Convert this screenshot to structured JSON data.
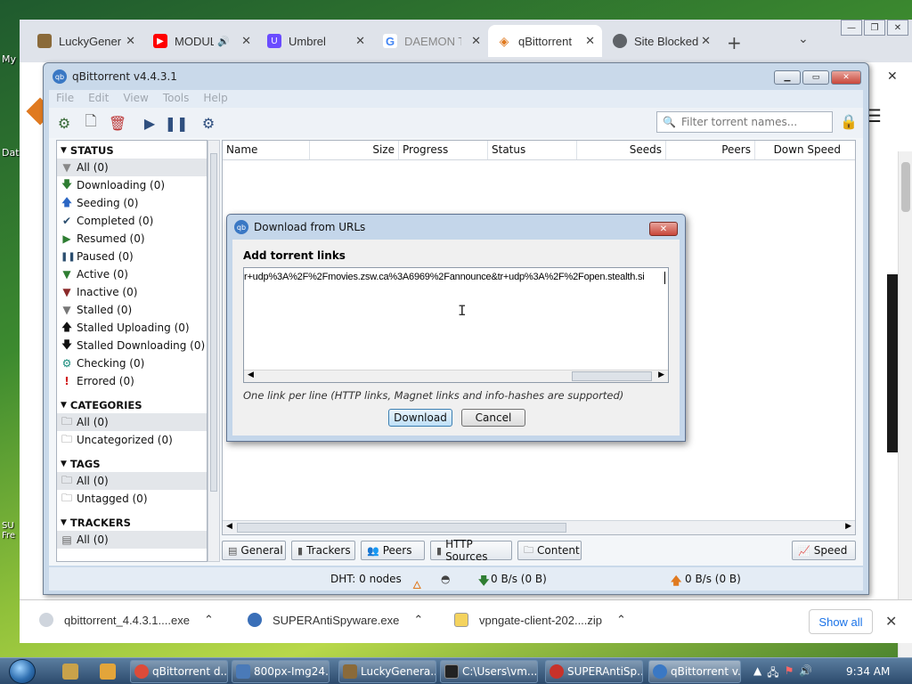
{
  "desktop": {
    "icons": [
      "My",
      "Dat",
      "SU Fre"
    ]
  },
  "browser": {
    "tabs": [
      {
        "title": "LuckyGener",
        "icon": "lucky-icon",
        "color": "#8a6a3a"
      },
      {
        "title": "MODUL",
        "icon": "youtube-icon",
        "color": "#ff0000"
      },
      {
        "title": "Umbrel",
        "icon": "umbrel-icon",
        "color": "#6a4cff"
      },
      {
        "title": "DAEMON To",
        "icon": "google-icon",
        "color": "#4285f4"
      },
      {
        "title": "qBittorrent",
        "icon": "diamond-icon",
        "color": "#e07a20"
      },
      {
        "title": "Site Blocked",
        "icon": "globe-icon",
        "color": "#5f6368"
      }
    ],
    "new_tab": "+",
    "downloads": [
      {
        "name": "qbittorrent_4.4.3.1....exe",
        "icon": "qbittorrent-file-icon"
      },
      {
        "name": "SUPERAntiSpyware.exe",
        "icon": "superantispyware-file-icon"
      },
      {
        "name": "vpngate-client-202....zip",
        "icon": "zip-file-icon"
      }
    ],
    "show_all": "Show all"
  },
  "qbittorrent": {
    "title": "qBittorrent v4.4.3.1",
    "menu": [
      "File",
      "Edit",
      "View",
      "Tools",
      "Help"
    ],
    "filter_placeholder": "Filter torrent names...",
    "sidebar": {
      "status_header": "STATUS",
      "status_items": [
        {
          "label": "All (0)",
          "icon": "filter-icon",
          "selected": true
        },
        {
          "label": "Downloading (0)",
          "icon": "down-arrow-icon"
        },
        {
          "label": "Seeding (0)",
          "icon": "up-arrow-icon"
        },
        {
          "label": "Completed (0)",
          "icon": "checkmark-icon"
        },
        {
          "label": "Resumed (0)",
          "icon": "play-icon"
        },
        {
          "label": "Paused (0)",
          "icon": "pause-icon"
        },
        {
          "label": "Active (0)",
          "icon": "filter-green-icon"
        },
        {
          "label": "Inactive (0)",
          "icon": "filter-red-icon"
        },
        {
          "label": "Stalled (0)",
          "icon": "filter-gray-icon"
        },
        {
          "label": "Stalled Uploading (0)",
          "icon": "up-black-icon"
        },
        {
          "label": "Stalled Downloading (0)",
          "icon": "down-black-icon"
        },
        {
          "label": "Checking (0)",
          "icon": "gear-teal-icon"
        },
        {
          "label": "Errored (0)",
          "icon": "exclamation-icon"
        }
      ],
      "categories_header": "CATEGORIES",
      "categories_items": [
        {
          "label": "All (0)",
          "selected": true
        },
        {
          "label": "Uncategorized (0)"
        }
      ],
      "tags_header": "TAGS",
      "tags_items": [
        {
          "label": "All (0)",
          "selected": true
        },
        {
          "label": "Untagged (0)"
        }
      ],
      "trackers_header": "TRACKERS",
      "trackers_items": [
        {
          "label": "All (0)",
          "selected": true
        }
      ]
    },
    "columns": [
      "Name",
      "Size",
      "Progress",
      "Status",
      "Seeds",
      "Peers",
      "Down Speed"
    ],
    "bottom_tabs": [
      "General",
      "Trackers",
      "Peers",
      "HTTP Sources",
      "Content"
    ],
    "speed_tab": "Speed",
    "statusbar": {
      "dht": "DHT: 0 nodes",
      "down": "0 B/s (0 B)",
      "up": "0 B/s (0 B)"
    }
  },
  "dialog": {
    "title": "Download from URLs",
    "label": "Add torrent links",
    "links_text": "r+udp%3A%2F%2Fmovies.zsw.ca%3A6969%2Fannounce&tr+udp%3A%2F%2Fopen.stealth.si",
    "hint": "One link per line (HTTP links, Magnet links and info-hashes are supported)",
    "download_button": "Download",
    "cancel_button": "Cancel"
  },
  "taskbar": {
    "buttons": [
      {
        "label": "qBittorrent d...",
        "icon": "chrome-icon",
        "color": "#dd4b39"
      },
      {
        "label": "800px-Img24...",
        "icon": "paint-icon",
        "color": "#4a7ab8"
      },
      {
        "label": "LuckyGenera...",
        "icon": "lucky-icon",
        "color": "#8a6a3a"
      },
      {
        "label": "C:\\Users\\vm...",
        "icon": "cmd-icon",
        "color": "#222222"
      },
      {
        "label": "SUPERAntiSp...",
        "icon": "superantispyware-icon",
        "color": "#c8322a"
      },
      {
        "label": "qBittorrent v...",
        "icon": "qbittorrent-icon",
        "color": "#3a78c4",
        "active": true
      }
    ],
    "clock": "9:34 AM"
  }
}
